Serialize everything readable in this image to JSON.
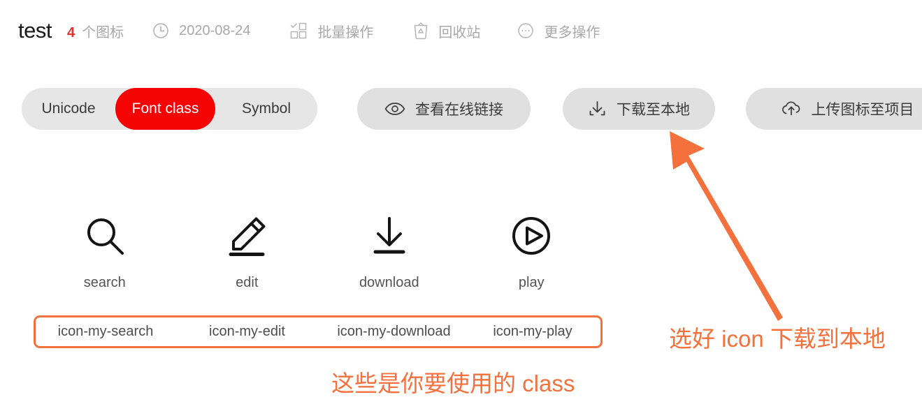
{
  "header": {
    "project_title": "test",
    "icon_count": "4",
    "icon_count_label": "个图标",
    "date": "2020-08-24",
    "batch_label": "批量操作",
    "recycle_label": "回收站",
    "more_label": "更多操作",
    "icons": {
      "clock": "clock-icon",
      "batch": "batch-select-icon",
      "recycle": "trash-icon",
      "more": "ellipsis-circle-icon"
    }
  },
  "toolbar": {
    "segmented": {
      "options": [
        "Unicode",
        "Font class",
        "Symbol"
      ],
      "selected": "Font class",
      "selected_bg": "#f40303",
      "track_bg": "#e6e6e6"
    },
    "buttons": [
      {
        "label": "查看在线链接",
        "icon": "eye-icon"
      },
      {
        "label": "下载至本地",
        "icon": "download-icon"
      },
      {
        "label": "上传图标至项目",
        "icon": "cloud-upload-icon"
      }
    ]
  },
  "icon_grid": {
    "items": [
      {
        "name": "search",
        "class": "icon-my-search",
        "glyph": "magnifier-icon"
      },
      {
        "name": "edit",
        "class": "icon-my-edit",
        "glyph": "pencil-icon"
      },
      {
        "name": "download",
        "class": "icon-my-download",
        "glyph": "download-arrow-icon"
      },
      {
        "name": "play",
        "class": "icon-my-play",
        "glyph": "play-circle-icon"
      }
    ]
  },
  "annotations": {
    "class_note": "这些是你要使用的 class",
    "download_note": "选好 icon 下载到本地",
    "accent_color": "#f4713d",
    "arrow": "callout-arrow"
  }
}
